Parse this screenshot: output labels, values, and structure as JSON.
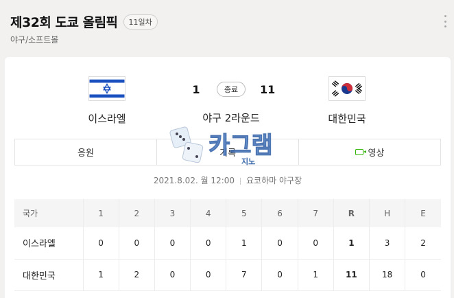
{
  "header": {
    "title": "제32회 도쿄 올림픽",
    "day_badge": "11일차",
    "subtitle": "야구/소프트볼"
  },
  "match": {
    "home": {
      "name": "이스라엘",
      "score": "1",
      "flag": "israel-flag-icon"
    },
    "away": {
      "name": "대한민국",
      "score": "11",
      "flag": "korea-flag-icon"
    },
    "status": "종료",
    "round": "야구 2라운드",
    "datetime": "2021.8.02. 월 12:00",
    "venue": "요코하마 야구장"
  },
  "actions": {
    "cheer": "응원",
    "record": "기록",
    "video": "영상"
  },
  "linescore": {
    "headers": [
      "국가",
      "1",
      "2",
      "3",
      "4",
      "5",
      "6",
      "7",
      "R",
      "H",
      "E"
    ],
    "rows": [
      [
        "이스라엘",
        "0",
        "0",
        "0",
        "0",
        "1",
        "0",
        "0",
        "1",
        "3",
        "2"
      ],
      [
        "대한민국",
        "1",
        "2",
        "0",
        "0",
        "7",
        "0",
        "1",
        "11",
        "18",
        "0"
      ]
    ]
  },
  "watermark": {
    "text": "카그램",
    "sub": "지노"
  },
  "colors": {
    "video_icon": "#2db400",
    "page_bg": "#f2f1f0"
  }
}
